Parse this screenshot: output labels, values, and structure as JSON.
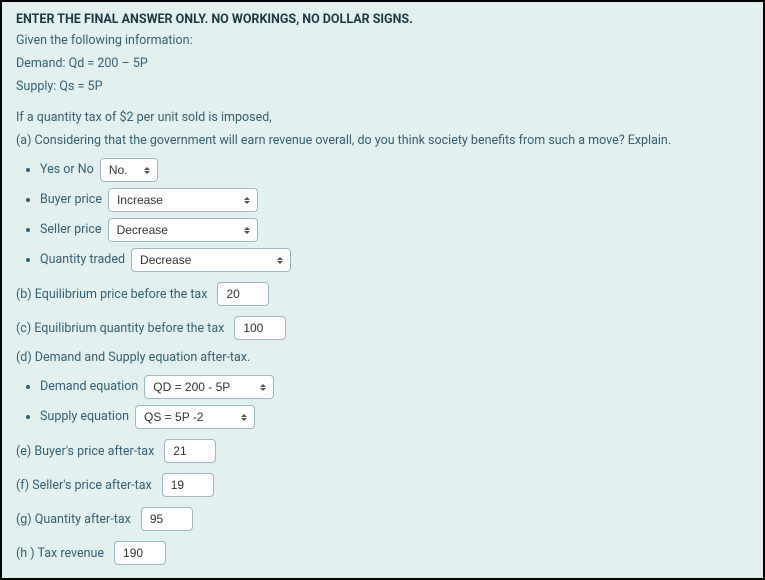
{
  "header": {
    "title": "ENTER THE FINAL ANSWER ONLY. NO WORKINGS, NO DOLLAR SIGNS.",
    "given": "Given the following information:",
    "demand": "Demand: Qd = 200 – 5P",
    "supply": "Supply: Qs = 5P"
  },
  "intro": {
    "tax_line": "If a quantity tax of $2 per unit sold is imposed,",
    "a_line": "(a) Considering that the government will earn revenue overall, do you think society benefits from such a move? Explain."
  },
  "bullets_a": {
    "yes_no_label": "Yes or No",
    "yes_no_value": "No.",
    "buyer_label": "Buyer price",
    "buyer_value": "Increase",
    "seller_label": "Seller price",
    "seller_value": "Decrease",
    "qty_label": "Quantity traded",
    "qty_value": "Decrease"
  },
  "labels": {
    "b": "(b) Equilibrium price before the tax",
    "c": "(c) Equilibrium quantity before the tax",
    "d": "(d) Demand and Supply equation after-tax.",
    "demand_eq_label": "Demand equation",
    "supply_eq_label": "Supply equation",
    "e": "(e) Buyer's price after-tax",
    "f": "(f) Seller's price after-tax",
    "g": "(g) Quantity after-tax",
    "h": "(h ) Tax revenue"
  },
  "values": {
    "b": "20",
    "c": "100",
    "demand_eq": "QD = 200 - 5P",
    "supply_eq": "QS = 5P -2",
    "e": "21",
    "f": "19",
    "g": "95",
    "h": "190"
  }
}
